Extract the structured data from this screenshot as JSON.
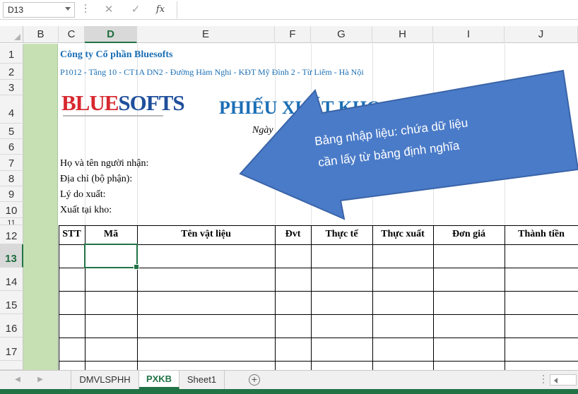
{
  "formula_bar": {
    "name_box": "D13",
    "cancel_icon": "✕",
    "confirm_icon": "✓",
    "fx_label": "fx",
    "formula": ""
  },
  "columns": [
    "B",
    "C",
    "D",
    "E",
    "F",
    "G",
    "H",
    "I",
    "J"
  ],
  "active_column": "D",
  "rows": [
    "1",
    "2",
    "3",
    "4",
    "5",
    "6",
    "7",
    "8",
    "9",
    "10",
    "11",
    "12",
    "13",
    "14",
    "15",
    "16",
    "17"
  ],
  "active_row": "13",
  "sheet": {
    "company": "Công ty Cổ phần Bluesofts",
    "address": "P1012 - Tầng 10 - CT1A DN2 - Đường Hàm Nghi - KĐT Mỹ Đình 2 - Từ Liêm - Hà Nội",
    "logo_left": "BLUE",
    "logo_right": "SOFTS",
    "doc_title": "PHIẾU XUẤT KHO",
    "doc_date": "Ngày",
    "labels": {
      "receiver": "Họ và tên người nhận:",
      "address": "Địa chỉ (bộ phận):",
      "reason": "Lý do xuất:",
      "warehouse": "Xuất tại kho:"
    },
    "table_headers": [
      "STT",
      "Mã",
      "Tên vật liệu",
      "Đvt",
      "Thực tế",
      "Thực xuất",
      "Đơn giá",
      "Thành tiền"
    ]
  },
  "callout": {
    "line1": "Bảng nhập liệu: chứa dữ liệu",
    "line2": "cần lấy từ bảng định nghĩa",
    "color": "#4a7bc8"
  },
  "tabs": {
    "items": [
      "DMVLSPHH",
      "PXKB",
      "Sheet1"
    ],
    "active": "PXKB",
    "add_label": "+"
  },
  "colors": {
    "excel_green": "#217346",
    "column_b_fill": "#c6e0b4",
    "company_blue": "#1b6fb5"
  }
}
